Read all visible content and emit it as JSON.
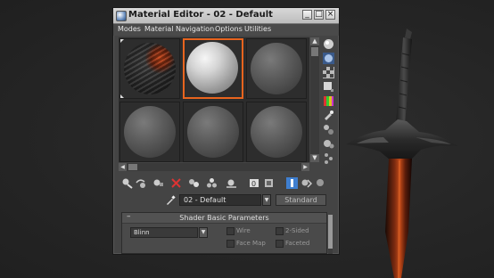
{
  "window": {
    "title": "Material Editor - 02 - Default",
    "minimize_symbol": "_",
    "maximize_symbol": "□",
    "close_symbol": "×"
  },
  "menu": [
    "Modes",
    "Material",
    "Navigation",
    "Options",
    "Utilities"
  ],
  "slots": {
    "selected_index": 1,
    "count": 6,
    "items": [
      {
        "kind": "dark-textured",
        "icon": "sphere-preview"
      },
      {
        "kind": "active-default",
        "icon": "sphere-preview"
      },
      {
        "kind": "default",
        "icon": "sphere-preview"
      },
      {
        "kind": "default",
        "icon": "sphere-preview"
      },
      {
        "kind": "default",
        "icon": "sphere-preview"
      },
      {
        "kind": "default",
        "icon": "sphere-preview"
      }
    ]
  },
  "side_toolbar": [
    "sample-type-icon",
    "backlight-icon",
    "background-icon",
    "uv-tiling-icon",
    "video-color-check-icon",
    "make-preview-icon",
    "options-icon",
    "select-by-material-icon",
    "material-navigator-icon"
  ],
  "bottom_toolbar": [
    "get-material-icon",
    "put-to-scene-icon",
    "assign-to-selection-icon",
    "reset-map-icon",
    "make-copy-icon",
    "make-unique-icon",
    "put-to-library-icon",
    "material-id-channel-icon",
    "show-shaded-map-icon",
    "show-end-result-icon",
    "go-to-parent-icon",
    "go-forward-icon"
  ],
  "material_name": "02 - Default",
  "material_type": "Standard",
  "rollout": {
    "title": "Shader Basic Parameters",
    "collapse_symbol": "–",
    "shader": "Blinn",
    "options": [
      {
        "label": "Wire",
        "checked": false
      },
      {
        "label": "2-Sided",
        "checked": false
      },
      {
        "label": "Face Map",
        "checked": false
      },
      {
        "label": "Faceted",
        "checked": false
      }
    ]
  },
  "colors": {
    "selected_slot_border": "#e8641e",
    "viewport_background": "#262626",
    "active_toggle": "#3f7fd0"
  }
}
